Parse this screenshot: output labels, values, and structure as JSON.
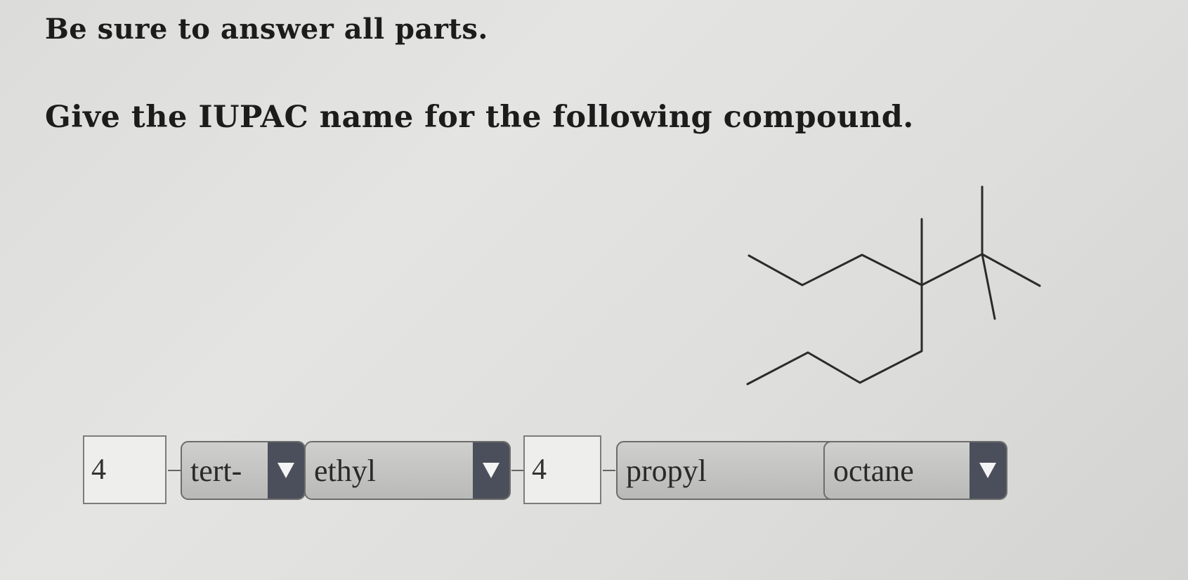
{
  "instruction": "Be sure to answer all parts.",
  "question": "Give the IUPAC name for the following compound.",
  "answer": {
    "locant_1": "4",
    "substituent_1": "tert-",
    "substituent_2": "ethyl",
    "locant_2": "4",
    "substituent_3": "propyl",
    "parent_chain": "octane"
  },
  "colors": {
    "background": "#dededc",
    "dropdown_arrow": "#4b4f5b",
    "dropdown_body": "#c4c4c2",
    "text": "#1c1c1c"
  },
  "icons": {
    "dropdown": "triangle-down-icon"
  }
}
